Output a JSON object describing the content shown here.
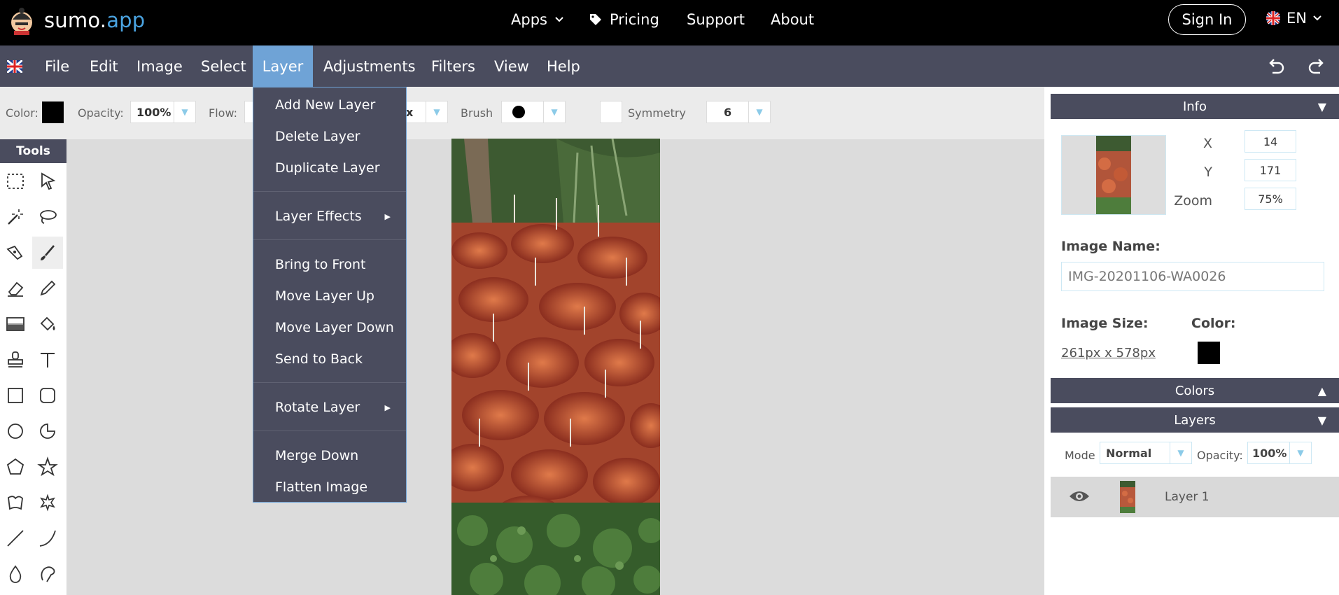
{
  "brand": {
    "name_main": "sumo.",
    "name_accent": "app"
  },
  "topnav": {
    "apps": "Apps",
    "pricing": "Pricing",
    "support": "Support",
    "about": "About",
    "signin": "Sign In",
    "lang": "EN"
  },
  "menubar": [
    "File",
    "Edit",
    "Image",
    "Select",
    "Layer",
    "Adjustments",
    "Filters",
    "View",
    "Help"
  ],
  "options": {
    "color_label": "Color:",
    "opacity_label": "Opacity:",
    "opacity_value": "100%",
    "flow_label": "Flow:",
    "hidden_value": "ox",
    "brush_label": "Brush",
    "symmetry_label": "Symmetry",
    "symmetry_value": "6"
  },
  "tools": {
    "header": "Tools"
  },
  "layer_menu": {
    "add": "Add New Layer",
    "delete": "Delete Layer",
    "duplicate": "Duplicate Layer",
    "effects": "Layer Effects",
    "front": "Bring to Front",
    "up": "Move Layer Up",
    "down": "Move Layer Down",
    "back": "Send to Back",
    "rotate": "Rotate Layer",
    "merge": "Merge Down",
    "flatten": "Flatten Image"
  },
  "info": {
    "title": "Info",
    "x_label": "X",
    "x": "14",
    "y_label": "Y",
    "y": "171",
    "zoom_label": "Zoom",
    "zoom": "75%",
    "name_label": "Image Name:",
    "name": "IMG-20201106-WA0026",
    "size_label": "Image Size:",
    "size": "261px x 578px",
    "color_label": "Color:"
  },
  "colors_panel": {
    "title": "Colors"
  },
  "layers_panel": {
    "title": "Layers",
    "mode_label": "Mode",
    "mode": "Normal",
    "opacity_label": "Opacity:",
    "opacity": "100%",
    "layer_name": "Layer 1"
  },
  "colors": {
    "topbar": "#000000",
    "menubar": "#4a4c5e",
    "accent": "#6fa3d6",
    "brand_accent": "#4aa3e0"
  }
}
